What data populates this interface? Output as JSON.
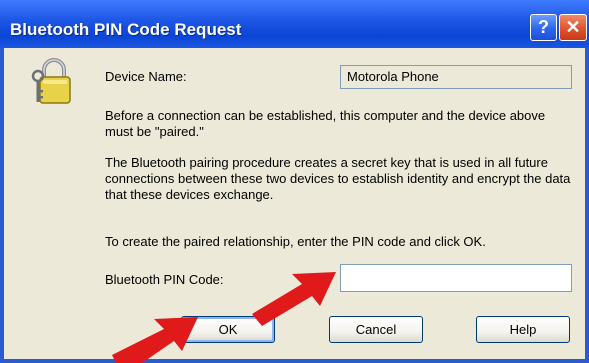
{
  "window": {
    "title": "Bluetooth PIN Code Request",
    "help_glyph": "?",
    "close_glyph": "✕"
  },
  "device": {
    "name_label": "Device Name:",
    "name_value": "Motorola Phone"
  },
  "paragraphs": {
    "p1": "Before a connection can be established, this computer and the device above must be \"paired.\"",
    "p2": "The Bluetooth pairing procedure creates a secret key that is used in all future connections between these two devices to establish identity and encrypt the data that these devices exchange.",
    "p3": "To create the paired relationship, enter the PIN code and click OK."
  },
  "pin": {
    "label": "Bluetooth PIN Code:",
    "value": ""
  },
  "buttons": {
    "ok": "OK",
    "cancel": "Cancel",
    "help": "Help"
  },
  "icons": {
    "window_icon": "lock-key-icon",
    "pointer_arrows": "red-arrow-icon"
  },
  "colors": {
    "title_bar": "#1f58e6",
    "dialog_bg": "#ece9d8",
    "arrow": "#e01a1a",
    "close_btn": "#e0542f"
  }
}
